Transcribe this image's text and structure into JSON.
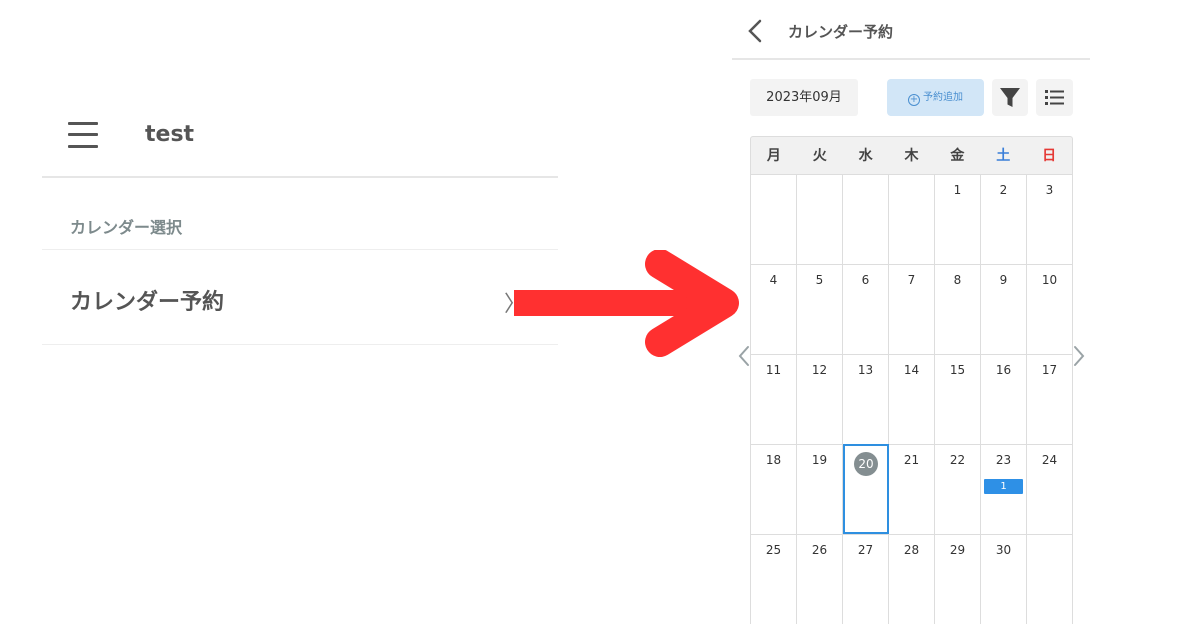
{
  "left": {
    "header_title": "test",
    "section_label": "カレンダー選択",
    "list_item_label": "カレンダー予約",
    "list_item_chevron": "〉"
  },
  "right": {
    "header_title": "カレンダー予約",
    "month_label": "2023年09月",
    "add_button_label": "予約追加",
    "weekdays": [
      "月",
      "火",
      "水",
      "木",
      "金",
      "土",
      "日"
    ],
    "days": [
      "",
      "",
      "",
      "",
      "1",
      "2",
      "3",
      "4",
      "5",
      "6",
      "7",
      "8",
      "9",
      "10",
      "11",
      "12",
      "13",
      "14",
      "15",
      "16",
      "17",
      "18",
      "19",
      "20",
      "21",
      "22",
      "23",
      "24",
      "25",
      "26",
      "27",
      "28",
      "29",
      "30",
      ""
    ],
    "today": "20",
    "reservation_badge": {
      "day": "23",
      "count": "1"
    }
  },
  "colors": {
    "arrow": "#ff3030",
    "accent_blue": "#2e8fe0",
    "saturday": "#3b7fd9",
    "sunday": "#e53935",
    "today_circle": "#848e91",
    "add_button_bg": "#d2e6f7"
  },
  "icons": [
    "hamburger-icon",
    "back-chevron-icon",
    "plus-circle-icon",
    "filter-icon",
    "list-icon",
    "chevron-left-icon",
    "chevron-right-icon",
    "arrow-right-icon"
  ]
}
